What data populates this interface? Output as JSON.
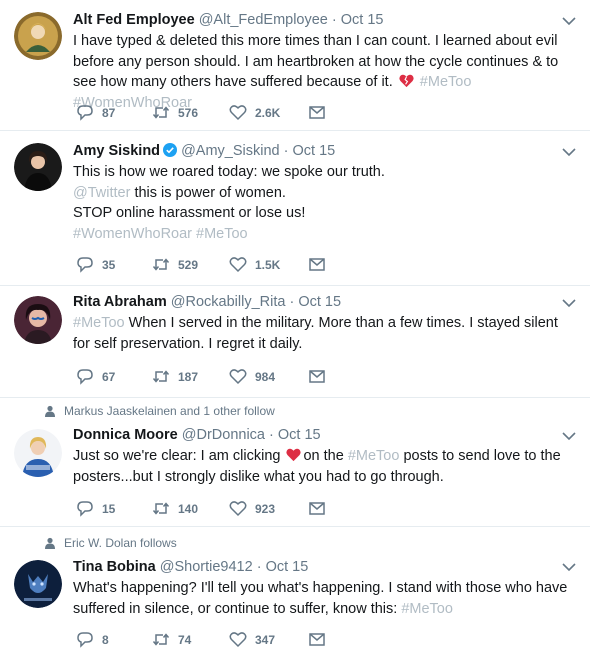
{
  "tweets": [
    {
      "name": "Alt Fed Employee",
      "handle": "@Alt_FedEmployee",
      "time": "Oct 15",
      "verified": false,
      "text_parts": [
        {
          "t": "I have typed & deleted this more times than I can count. I learned about evil before any person should. I am heartbroken at how the cycle continues & to see how many others have suffered because of it. ",
          "k": "text"
        },
        {
          "t": "broken-heart-emoji",
          "k": "emoji"
        },
        {
          "t": " ",
          "k": "text"
        },
        {
          "t": "#MeToo",
          "k": "tag"
        },
        {
          "t": " ",
          "k": "text"
        },
        {
          "t": "#WomenWhoRoar",
          "k": "tag"
        }
      ],
      "replies": "87",
      "retweets": "576",
      "likes": "2.6K",
      "avatar_color": "#8a6a2c"
    },
    {
      "name": "Amy Siskind",
      "handle": "@Amy_Siskind",
      "time": "Oct 15",
      "verified": true,
      "text_parts": [
        {
          "t": "This is how we roared today: we spoke our truth.",
          "k": "line"
        },
        {
          "t": "@Twitter",
          "k": "mention"
        },
        {
          "t": " this is power of women.",
          "k": "text"
        },
        {
          "t": "STOP online harassment or lose us!",
          "k": "line"
        },
        {
          "t": "#WomenWhoRoar #MeToo",
          "k": "tagline"
        }
      ],
      "replies": "35",
      "retweets": "529",
      "likes": "1.5K",
      "avatar_color": "#1a1a1a"
    },
    {
      "name": "Rita Abraham",
      "handle": "@Rockabilly_Rita",
      "time": "Oct 15",
      "verified": false,
      "text_parts": [
        {
          "t": "#MeToo",
          "k": "tag"
        },
        {
          "t": " When I served in the military. More than a few times. I stayed silent for self preservation. I regret it daily.",
          "k": "text"
        }
      ],
      "replies": "67",
      "retweets": "187",
      "likes": "984",
      "avatar_color": "#4a2535"
    },
    {
      "social_context": "Markus Jaaskelainen and 1 other follow",
      "name": "Donnica Moore",
      "handle": "@DrDonnica",
      "time": "Oct 15",
      "verified": false,
      "text_parts": [
        {
          "t": "Just so we're clear: I am clicking ",
          "k": "text"
        },
        {
          "t": "heart-emoji",
          "k": "emoji"
        },
        {
          "t": "on the ",
          "k": "text"
        },
        {
          "t": "#MeToo",
          "k": "tag"
        },
        {
          "t": " posts to send love to the posters...but I strongly dislike what you had to go through.",
          "k": "text"
        }
      ],
      "replies": "15",
      "retweets": "140",
      "likes": "923",
      "avatar_color": "#2a5fb0"
    },
    {
      "social_context": "Eric W. Dolan follows",
      "name": "Tina Bobina",
      "handle": "@Shortie9412",
      "time": "Oct 15",
      "verified": false,
      "text_parts": [
        {
          "t": "What's happening? I'll tell you what's happening. I stand with those who have suffered in silence, or continue to suffer, know this: ",
          "k": "text"
        },
        {
          "t": "#MeToo",
          "k": "tag"
        }
      ],
      "replies": "8",
      "retweets": "74",
      "likes": "347",
      "avatar_color": "#0d1f3c"
    }
  ],
  "colors": {
    "text": "#14171a",
    "meta": "#657786",
    "faded_link": "#b1bcc4",
    "verified": "#1da1f2",
    "divider": "#e6ecf0",
    "heart": "#e0245e"
  }
}
